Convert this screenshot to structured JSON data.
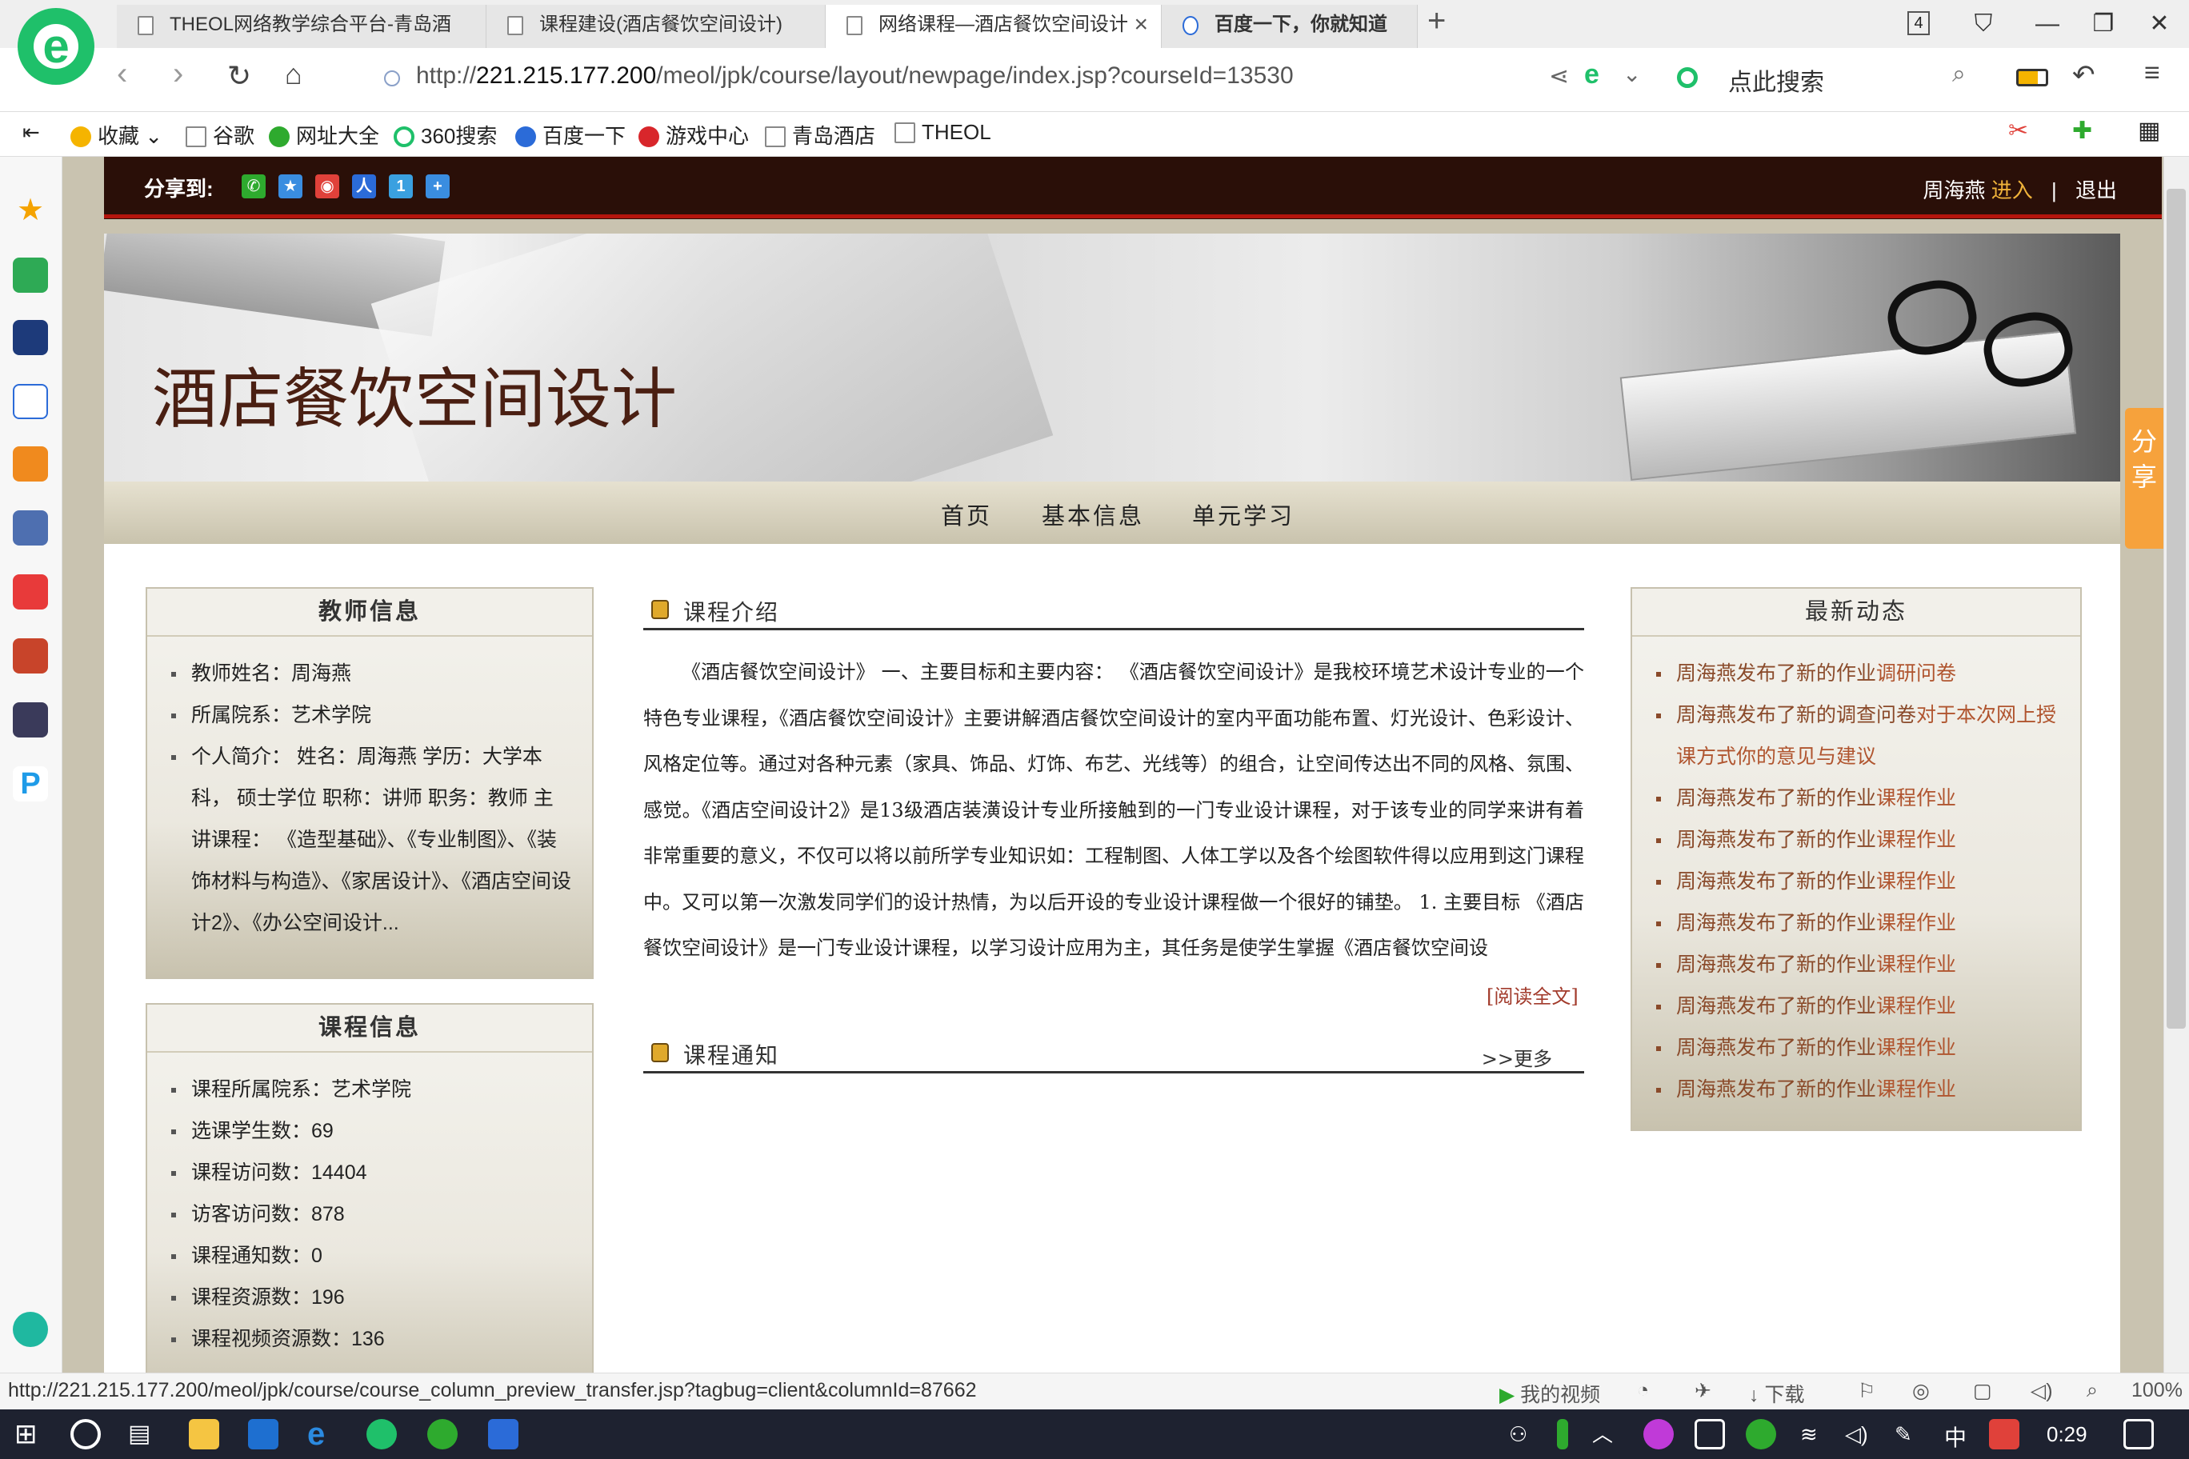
{
  "browser": {
    "tabs": [
      {
        "title": "THEOL网络教学综合平台-青岛酒"
      },
      {
        "title": "课程建设(酒店餐饮空间设计)"
      },
      {
        "title": "网络课程—酒店餐饮空间设计"
      },
      {
        "title": "百度一下，你就知道"
      }
    ],
    "tab_count": "4",
    "url_prefix": "http://",
    "url_host": "221.215.177.200",
    "url_path": "/meol/jpk/course/layout/newpage/index.jsp?courseId=13530",
    "search_placeholder": "点此搜索",
    "bookmarks": [
      "收藏",
      "谷歌",
      "网址大全",
      "360搜索",
      "百度一下",
      "游戏中心",
      "青岛酒店",
      "THEOL"
    ]
  },
  "page": {
    "share_label": "分享到:",
    "user_name": "周海燕",
    "enter_label": "进入",
    "separator": "|",
    "logout_label": "退出",
    "course_title": "酒店餐饮空间设计",
    "nav": [
      "首页",
      "基本信息",
      "单元学习"
    ],
    "side_share": [
      "分",
      "享"
    ],
    "teacher_panel": {
      "title": "教师信息",
      "items": [
        "教师姓名：周海燕",
        "所属院系：艺术学院",
        "个人简介： 姓名：周海燕 学历：大学本科， 硕士学位 职称：讲师 职务：教师 主讲课程： 《造型基础》、《专业制图》、《装饰材料与构造》、《家居设计》、《酒店空间设计2》、《办公空间设计..."
      ]
    },
    "course_panel": {
      "title": "课程信息",
      "items": [
        "课程所属院系：艺术学院",
        "选课学生数：69",
        "课程访问数：14404",
        "访客访问数：878",
        "课程通知数：0",
        "课程资源数：196",
        "课程视频资源数：136"
      ]
    },
    "intro": {
      "title": "课程介绍",
      "text": "《酒店餐饮空间设计》 一、主要目标和主要内容： 《酒店餐饮空间设计》是我校环境艺术设计专业的一个特色专业课程，《酒店餐饮空间设计》主要讲解酒店餐饮空间设计的室内平面功能布置、灯光设计、色彩设计、风格定位等。通过对各种元素（家具、饰品、灯饰、布艺、光线等）的组合，让空间传达出不同的风格、氛围、感觉。《酒店空间设计2》是13级酒店装潢设计专业所接触到的一门专业设计课程，对于该专业的同学来讲有着非常重要的意义，不仅可以将以前所学专业知识如：工程制图、人体工学以及各个绘图软件得以应用到这门课程中。又可以第一次激发同学们的设计热情，为以后开设的专业设计课程做一个很好的铺垫。 1. 主要目标 《酒店餐饮空间设计》是一门专业设计课程，以学习设计应用为主，其任务是使学生掌握《酒店餐饮空间设",
      "read_more": "[阅读全文]"
    },
    "notice": {
      "title": "课程通知",
      "more": ">>更多"
    },
    "news_panel": {
      "title": "最新动态",
      "items": [
        {
          "prefix": "周海燕发布了新的作业",
          "link": "调研问卷"
        },
        {
          "prefix": "周海燕发布了新的调查问卷",
          "link": "对于本次网上授课方式你的意见与建议"
        },
        {
          "prefix": "周海燕发布了新的作业",
          "link": "课程作业"
        },
        {
          "prefix": "周海燕发布了新的作业",
          "link": "课程作业"
        },
        {
          "prefix": "周海燕发布了新的作业",
          "link": "课程作业"
        },
        {
          "prefix": "周海燕发布了新的作业",
          "link": "课程作业"
        },
        {
          "prefix": "周海燕发布了新的作业",
          "link": "课程作业"
        },
        {
          "prefix": "周海燕发布了新的作业",
          "link": "课程作业"
        },
        {
          "prefix": "周海燕发布了新的作业",
          "link": "课程作业"
        },
        {
          "prefix": "周海燕发布了新的作业",
          "link": "课程作业"
        }
      ]
    }
  },
  "statusbar": {
    "url": "http://221.215.177.200/meol/jpk/course/course_column_preview_transfer.jsp?tagbug=client&columnId=87662",
    "my_video": "我的视频",
    "download": "下载",
    "zoom": "100%"
  },
  "taskbar": {
    "ime": "中",
    "time": "0:29"
  },
  "colors": {
    "accent_dark": "#2a0f08",
    "accent_red": "#b3150d",
    "title_brown": "#4a1f12",
    "link_brown": "#b0552f",
    "browser_green": "#1fc06a"
  }
}
